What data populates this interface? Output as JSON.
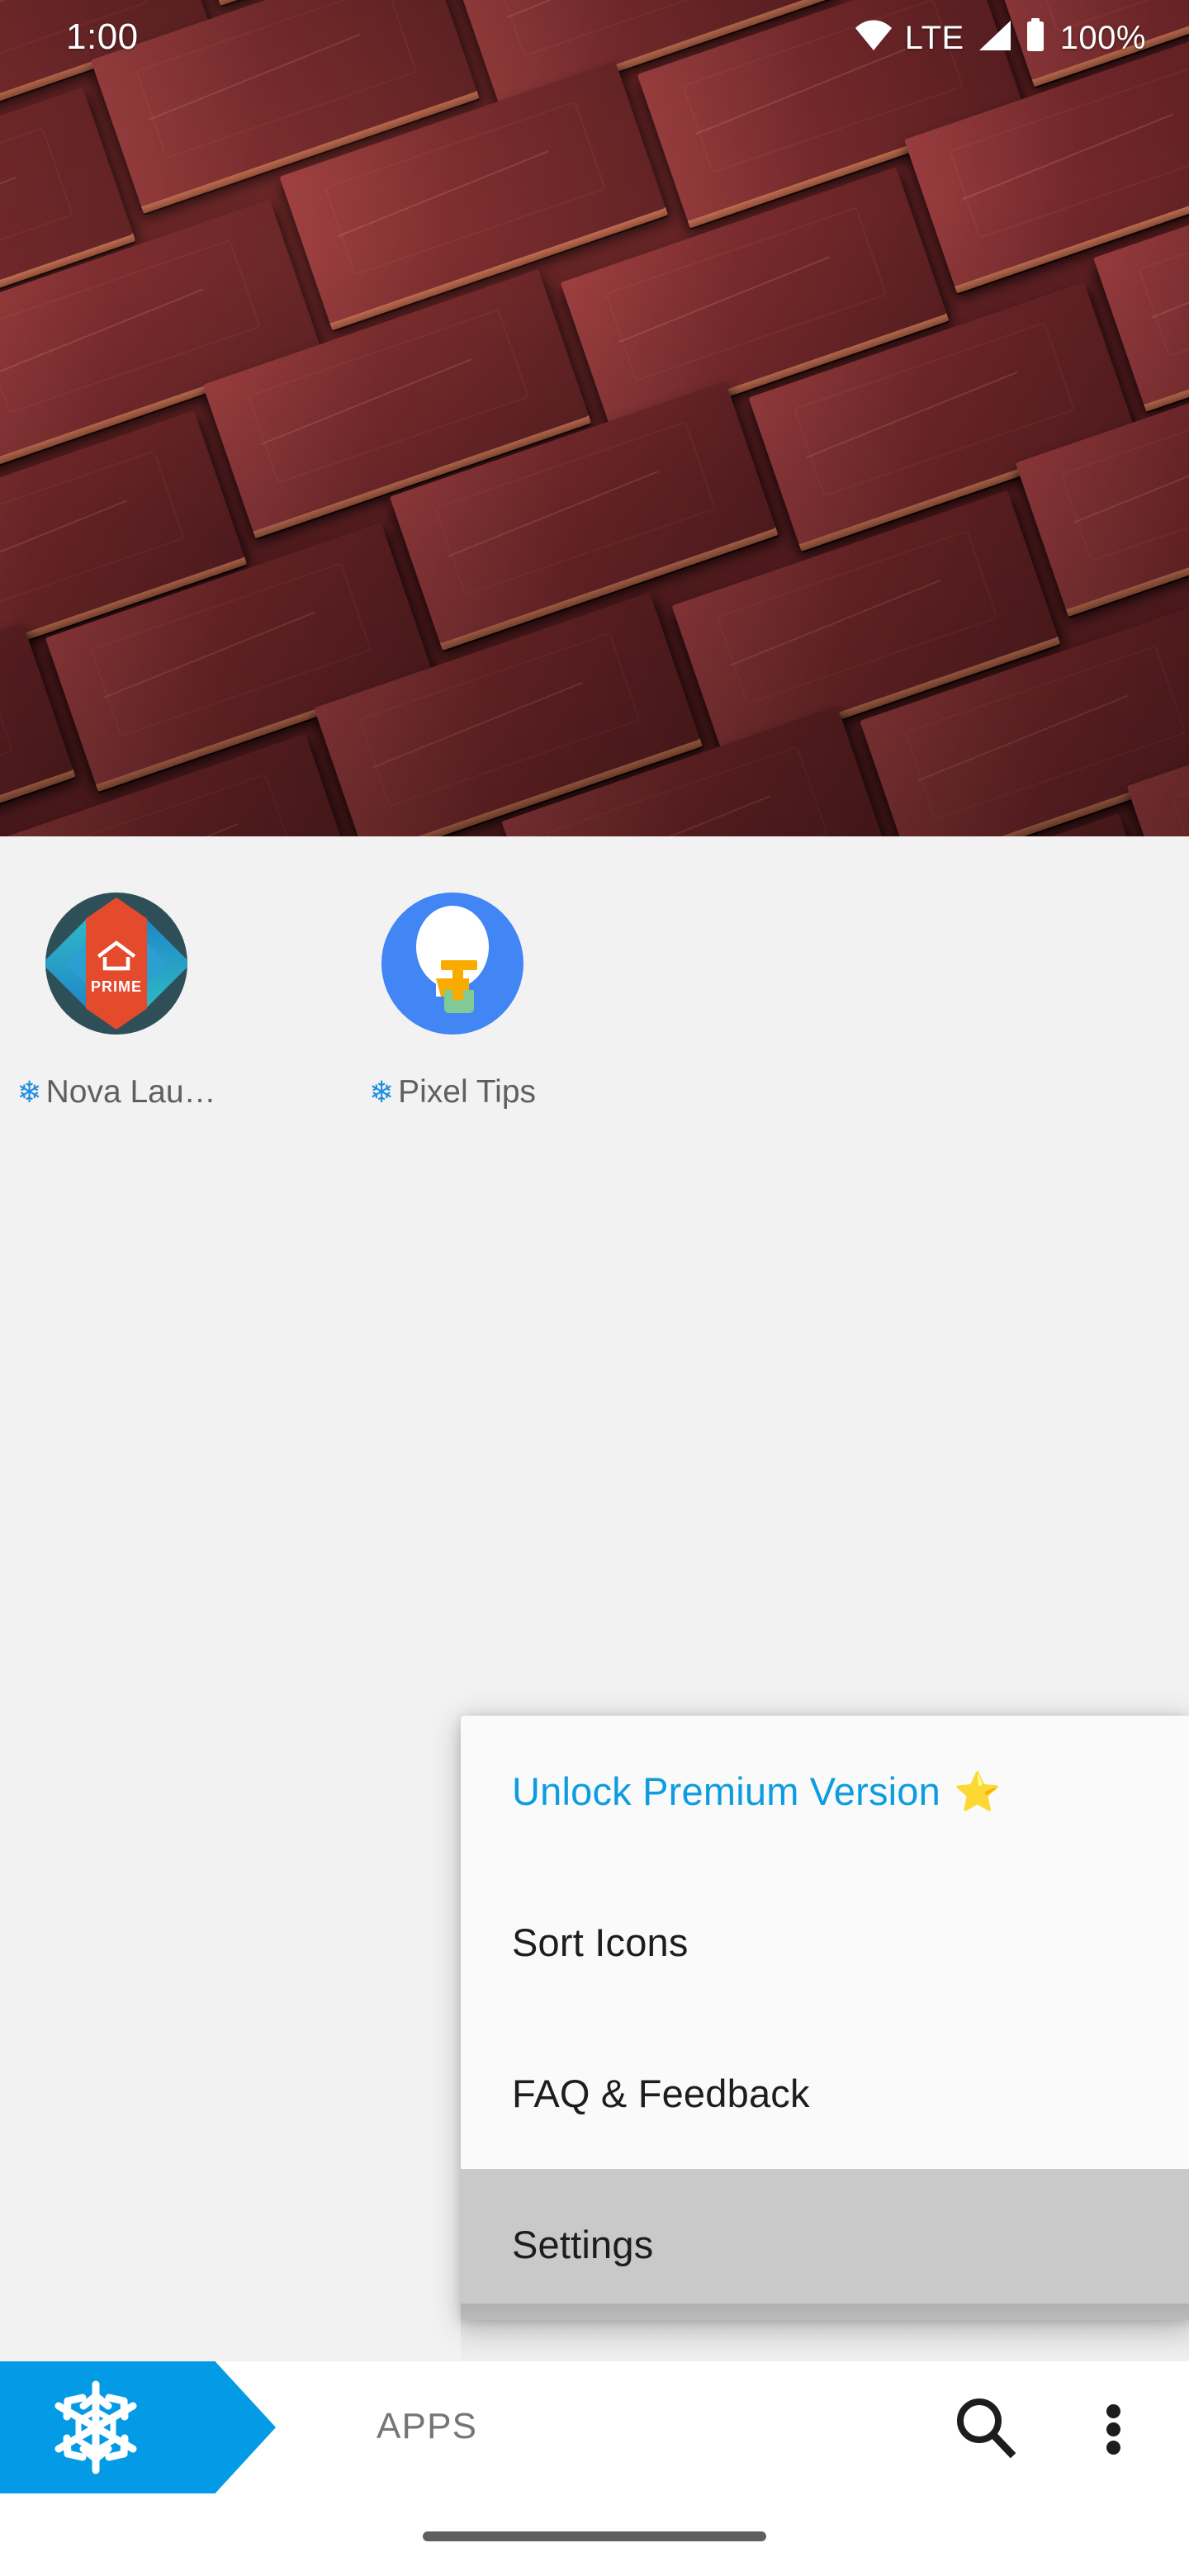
{
  "status_bar": {
    "clock": "1:00",
    "network_label": "LTE",
    "battery_percent": "100%",
    "icons": [
      "wifi-icon",
      "signal-icon",
      "battery-icon"
    ]
  },
  "app_drawer": {
    "background_color": "#f2f2f2",
    "apps": [
      {
        "name": "Nova Lau…",
        "full_name": "Nova Launcher",
        "icon": "nova-launcher-prime-icon",
        "badge_icon": "snowflake-icon",
        "badge_color": "#1e8ee0",
        "icon_badge_text": "PRIME"
      },
      {
        "name": "Pixel Tips",
        "icon": "pixel-tips-lightbulb-icon",
        "badge_icon": "snowflake-icon",
        "badge_color": "#1e8ee0"
      }
    ]
  },
  "overflow_menu": {
    "items": [
      {
        "label": "Unlock Premium Version",
        "trailing_icon": "star-icon",
        "trailing_glyph": "⭐",
        "color": "#0d9ce0",
        "pressed": false
      },
      {
        "label": "Sort Icons",
        "color": "#1d1d1d",
        "pressed": false
      },
      {
        "label": "FAQ & Feedback",
        "color": "#1d1d1d",
        "pressed": false
      },
      {
        "label": "Settings",
        "color": "#1d1d1d",
        "pressed": true
      }
    ]
  },
  "bottom_bar": {
    "tab_label": "APPS",
    "tab_icon": "snowflake-icon",
    "tab_color": "#039be5",
    "search_icon": "search-icon",
    "overflow_icon": "overflow-menu-icon"
  },
  "navigation_bar": {
    "home_indicator": "home-gesture-pill"
  }
}
